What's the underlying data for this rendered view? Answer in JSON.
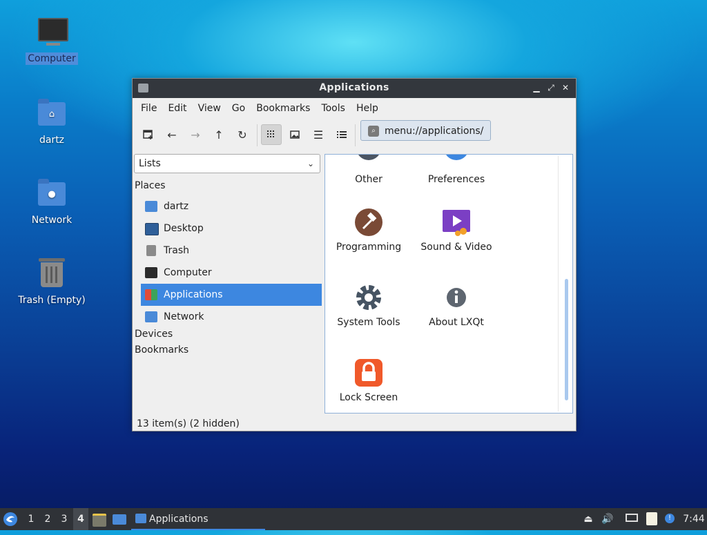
{
  "desktop": {
    "icons": [
      {
        "label": "Computer",
        "icon": "computer-icon"
      },
      {
        "label": "dartz",
        "icon": "home-folder-icon"
      },
      {
        "label": "Network",
        "icon": "network-folder-icon"
      },
      {
        "label": "Trash (Empty)",
        "icon": "trash-icon"
      }
    ]
  },
  "window": {
    "title": "Applications",
    "menu": [
      "File",
      "Edit",
      "View",
      "Go",
      "Bookmarks",
      "Tools",
      "Help"
    ],
    "path": "menu://applications/",
    "side_mode": "Lists",
    "places_heading": "Places",
    "places": [
      "dartz",
      "Desktop",
      "Trash",
      "Computer",
      "Applications",
      "Network"
    ],
    "selected_place": "Applications",
    "devices_heading": "Devices",
    "bookmarks_heading": "Bookmarks",
    "apps": [
      "Other",
      "Preferences",
      "Programming",
      "Sound & Video",
      "System Tools",
      "About LXQt",
      "Lock Screen"
    ],
    "status": "13 item(s) (2 hidden)"
  },
  "taskbar": {
    "workspaces": [
      "1",
      "2",
      "3",
      "4"
    ],
    "current_workspace": "4",
    "task": "Applications",
    "clock": "7:44"
  },
  "colors": {
    "selection": "#3d87e0",
    "titlebar": "#33373d",
    "taskbar": "#2f3237"
  }
}
